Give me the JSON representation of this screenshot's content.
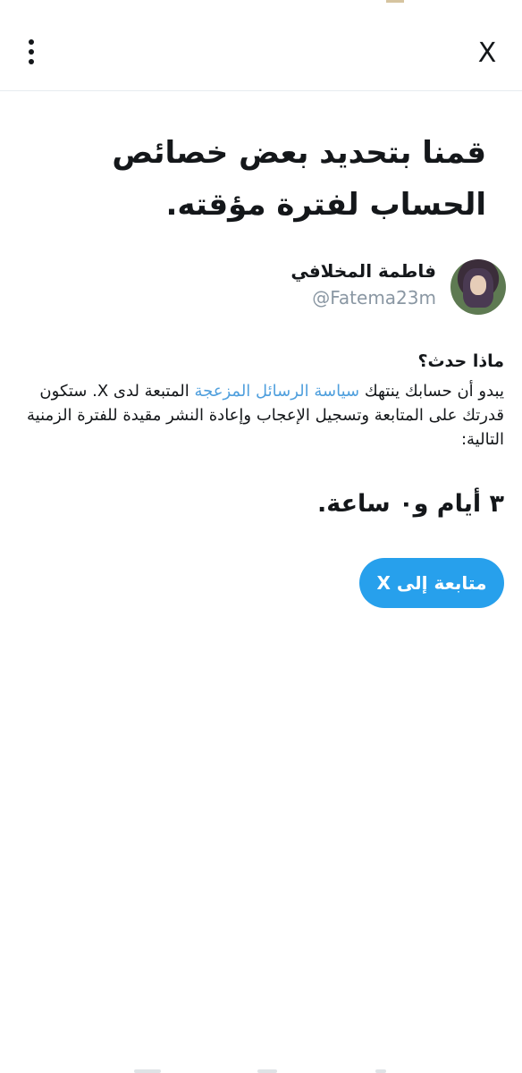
{
  "header": {
    "menu_icon": "vertical-ellipsis-icon",
    "close_label": "X"
  },
  "main": {
    "title": "قمنا بتحديد بعض خصائص الحساب لفترة مؤقته.",
    "user": {
      "display_name": "فاطمة المخلافي",
      "handle": "@Fatema23m"
    },
    "question": "ماذا حدث؟",
    "explanation": {
      "part1": "يبدو أن حسابك ينتهك ",
      "link": "سياسة الرسائل المزعجة",
      "part2": " المتبعة لدى X. ستكون قدرتك على المتابعة وتسجيل الإعجاب وإعادة النشر مقيدة للفترة الزمنية التالية:"
    },
    "duration": "٣ أيام و٠ ساعة.",
    "continue_label": "متابعة إلى X"
  },
  "colors": {
    "accent": "#27a0ec",
    "link": "#4f9fdd",
    "handle": "#8a97a3"
  }
}
